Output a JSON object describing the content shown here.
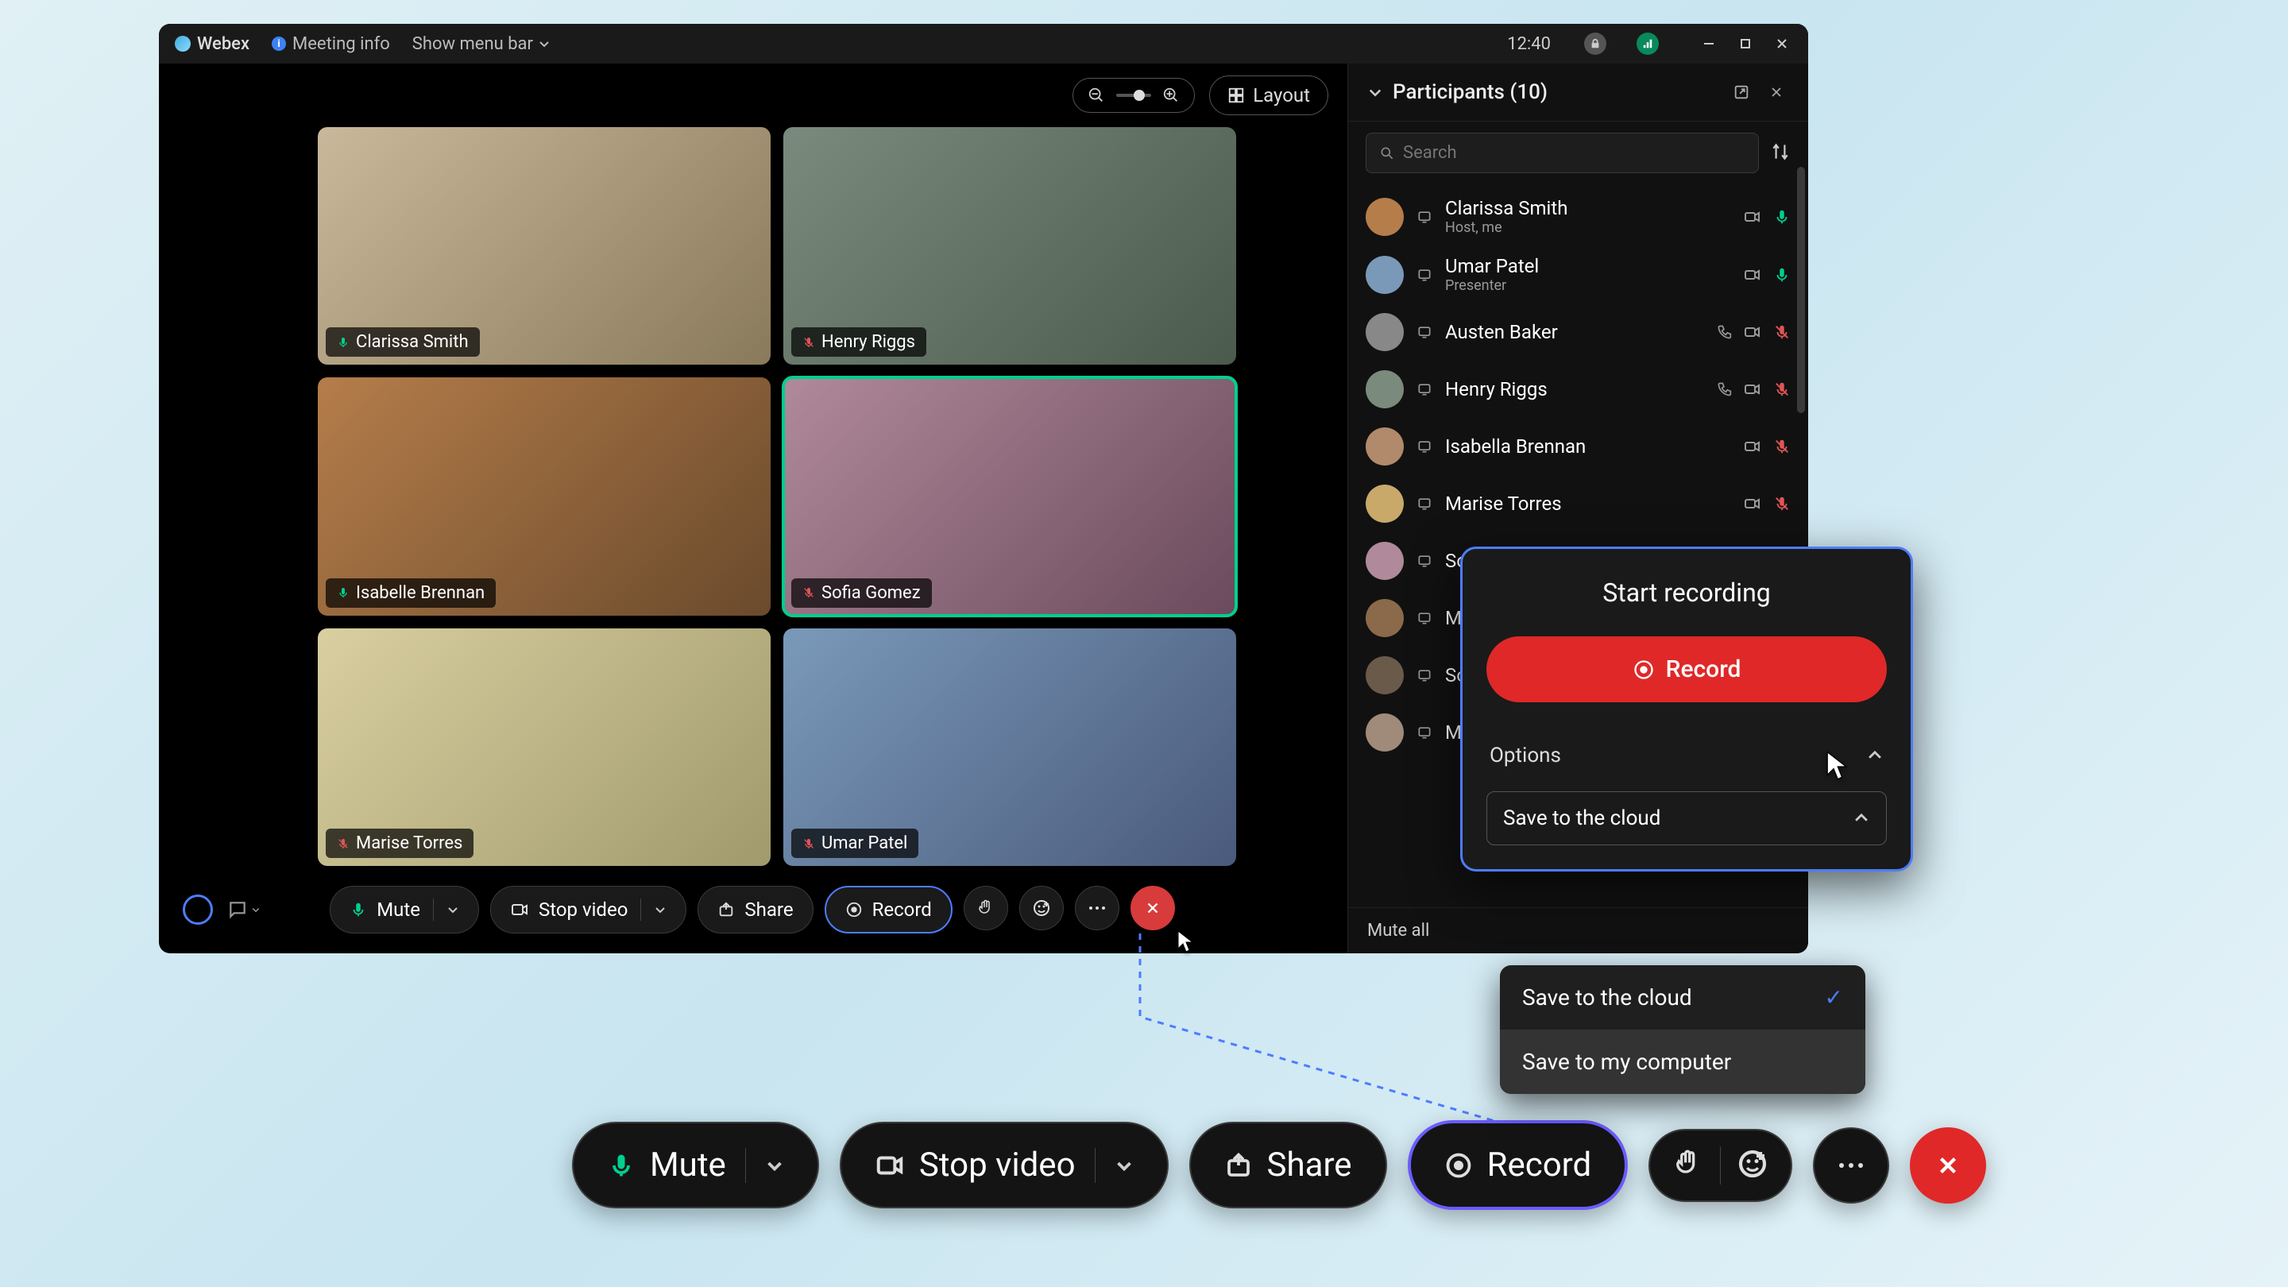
{
  "titlebar": {
    "app_name": "Webex",
    "meeting_info": "Meeting info",
    "show_menu": "Show menu bar",
    "clock": "12:40"
  },
  "top_controls": {
    "layout_label": "Layout"
  },
  "video_tiles": [
    {
      "name": "Clarissa Smith",
      "muted": false,
      "bg": "linear-gradient(135deg,#c9b89a,#8a7a5c)"
    },
    {
      "name": "Henry Riggs",
      "muted": true,
      "bg": "linear-gradient(135deg,#7a8a7c,#4a5a4c)"
    },
    {
      "name": "Isabelle Brennan",
      "muted": false,
      "bg": "linear-gradient(135deg,#b57d4a,#6a4a2c)"
    },
    {
      "name": "Sofia Gomez",
      "muted": true,
      "active": true,
      "bg": "linear-gradient(135deg,#b08a9a,#6a4a5c)"
    },
    {
      "name": "Marise Torres",
      "muted": true,
      "bg": "linear-gradient(135deg,#d9cfa0,#a09a6c)"
    },
    {
      "name": "Umar Patel",
      "muted": true,
      "bg": "linear-gradient(135deg,#7a99b9,#4a5a7c)"
    }
  ],
  "toolbar": {
    "mute": "Mute",
    "stop_video": "Stop video",
    "share": "Share",
    "record": "Record"
  },
  "participants": {
    "title": "Participants (10)",
    "search_placeholder": "Search",
    "mute_all": "Mute all",
    "list": [
      {
        "name": "Clarissa Smith",
        "role": "Host, me",
        "mic": "on",
        "video": true,
        "avatar": "#b57d4a"
      },
      {
        "name": "Umar Patel",
        "role": "Presenter",
        "mic": "on",
        "video": true,
        "avatar": "#7a99b9"
      },
      {
        "name": "Austen Baker",
        "role": "",
        "mic": "off",
        "video": true,
        "ext": true,
        "avatar": "#888"
      },
      {
        "name": "Henry Riggs",
        "role": "",
        "mic": "off",
        "video": true,
        "ext": true,
        "avatar": "#7a8a7c"
      },
      {
        "name": "Isabella Brennan",
        "role": "",
        "mic": "off",
        "video": true,
        "avatar": "#b08a6a"
      },
      {
        "name": "Marise Torres",
        "role": "",
        "mic": "off",
        "video": true,
        "avatar": "#c9a96a"
      },
      {
        "name": "Sof",
        "role": "",
        "mic": "",
        "video": false,
        "avatar": "#b08a9a"
      },
      {
        "name": "Mu",
        "role": "",
        "mic": "",
        "video": false,
        "avatar": "#8a6a4a"
      },
      {
        "name": "Sor",
        "role": "",
        "mic": "",
        "video": false,
        "avatar": "#6a5a4a"
      },
      {
        "name": "Ma",
        "role": "",
        "mic": "",
        "video": false,
        "avatar": "#a08a7a"
      }
    ]
  },
  "record_popover": {
    "title": "Start recording",
    "record_btn": "Record",
    "options_label": "Options",
    "select_value": "Save to the cloud"
  },
  "save_menu": {
    "opt1": "Save to the cloud",
    "opt2": "Save to my computer"
  },
  "big_toolbar": {
    "mute": "Mute",
    "stop_video": "Stop video",
    "share": "Share",
    "record": "Record"
  }
}
